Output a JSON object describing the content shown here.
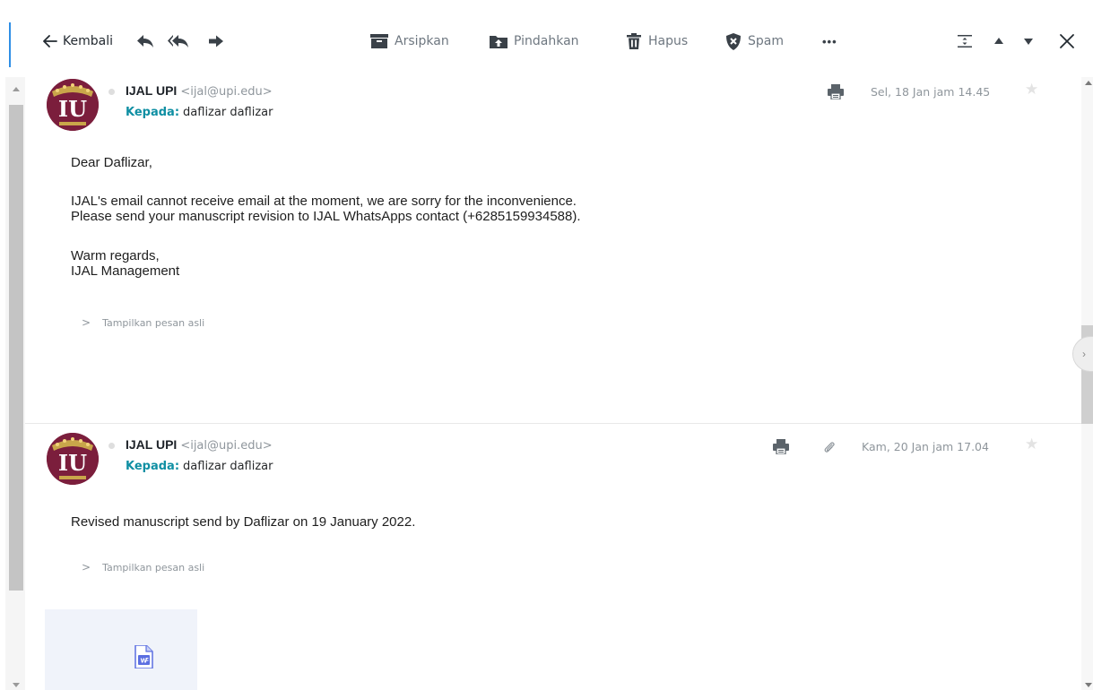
{
  "toolbar": {
    "back_label": "Kembali",
    "archive_label": "Arsipkan",
    "move_label": "Pindahkan",
    "delete_label": "Hapus",
    "spam_label": "Spam",
    "more_label": "•••"
  },
  "messages": [
    {
      "sender_name": "IJAL UPI",
      "sender_address": "<ijal@upi.edu>",
      "to_label": "Kepada:",
      "to_value": "daflizar daflizar",
      "date": "Sel, 18 Jan jam 14.45",
      "body": [
        "Dear Daflizar,",
        "IJAL's email cannot receive email at the moment, we are sorry for the inconvenience.",
        "Please send your manuscript revision to IJAL WhatsApps contact (+6285159934588).",
        "Warm regards,",
        "IJAL Management"
      ],
      "show_original": "Tampilkan pesan asli"
    },
    {
      "sender_name": "IJAL UPI",
      "sender_address": "<ijal@upi.edu>",
      "to_label": "Kepada:",
      "to_value": "daflizar daflizar",
      "date": "Kam, 20 Jan jam 17.04",
      "body": [
        "Revised manuscript send by Daflizar on 19 January 2022."
      ],
      "show_original": "Tampilkan pesan asli"
    }
  ],
  "avatar_logo_text": "IU",
  "colors": {
    "accent": "#0f8fa3",
    "avatar_bg": "#7b1e3c",
    "word_blue": "#2b579a"
  },
  "icons": [
    "back-arrow-icon",
    "reply-icon",
    "reply-all-icon",
    "forward-icon",
    "archive-icon",
    "move-icon",
    "trash-icon",
    "spam-shield-icon",
    "more-icon",
    "expand-collapse-icon",
    "previous-icon",
    "next-icon",
    "close-icon",
    "print-icon",
    "attachment-icon",
    "star-icon",
    "word-document-icon"
  ]
}
